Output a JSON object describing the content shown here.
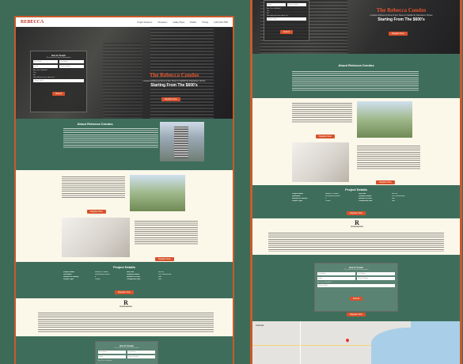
{
  "nav": {
    "brand": "REBECCA",
    "links": [
      "Project Features",
      "Floorplans",
      "Gallery Bpos",
      "Builder",
      "Pricing",
      "(416) 900-7650"
    ]
  },
  "hero": {
    "title": "The Rebecca Condos",
    "subtitle": "Located at Rebecca Street & Kerr Street in Oakville By Rosehaven Homes",
    "price": "Starting From The $600's",
    "cta": "Register Now"
  },
  "form": {
    "title": "Get In Touch",
    "subtitle": "To receive the latest Information",
    "fields": {
      "first": "First Name",
      "last": "Last Name",
      "email": "Email",
      "phone": "Phone Number",
      "realtor_q": "Are You a Realtor?",
      "yes": "Yes",
      "no": "No",
      "how": "How did you hear about us?",
      "select": "Please Select"
    },
    "submit": "Submit"
  },
  "about": {
    "title": "About Rebecca Condos",
    "btn1": "Register Now",
    "btn2": "Register Now",
    "btn3": "Register Now"
  },
  "details": {
    "title": "Project Details",
    "rows": [
      [
        "Project Name",
        "Rebecca Condos",
        "Unit Size",
        "Not Yet"
      ],
      [
        "Developer",
        "Rosehaven Homes",
        "Property Status",
        "Pre-Construction"
      ],
      [
        "Number of Storeys",
        "8",
        "Number of Units",
        "N/A"
      ],
      [
        "Project Type",
        "Condo",
        "Completion Date",
        "N/A"
      ]
    ],
    "cta": "Register Now"
  },
  "builder": {
    "name": "ROSEHAVEN",
    "tag": "ROSEHAVEN"
  },
  "contact": {
    "title": "Get In Touch",
    "subtitle": "To receive the latest Information",
    "submit": "Submit",
    "register": "Register Now"
  },
  "map": {
    "place": "Oakville"
  },
  "colors": {
    "accent": "#d9522b",
    "page_green": "#3e6e5b",
    "cream": "#fbf7e9"
  }
}
